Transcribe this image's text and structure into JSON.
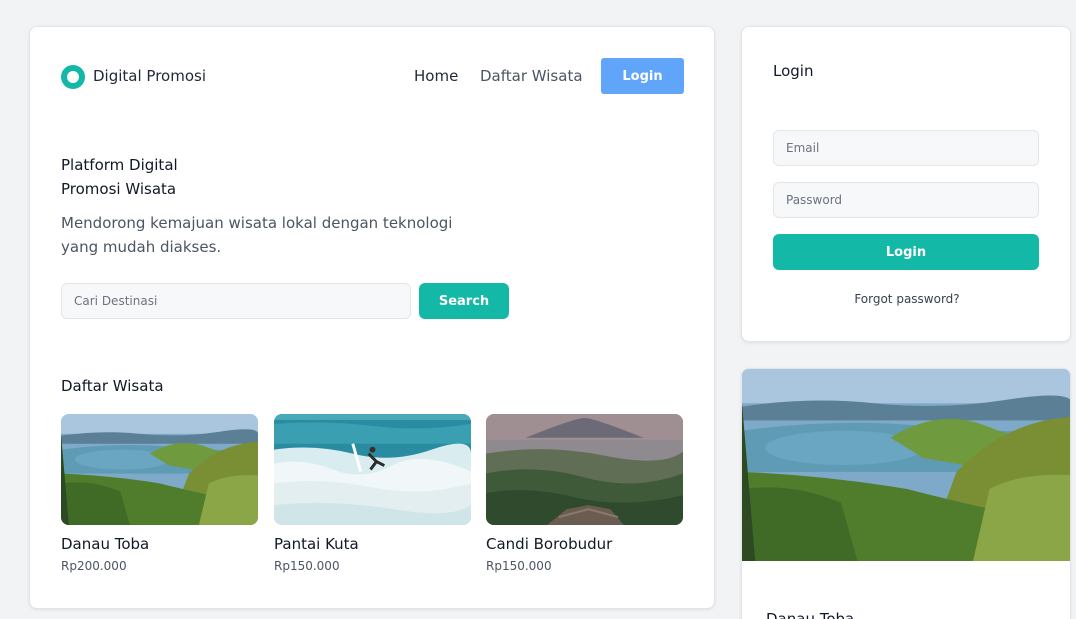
{
  "header": {
    "brand": "Digital Promosi",
    "nav": [
      "Home",
      "Daftar Wisata"
    ],
    "login_label": "Login"
  },
  "hero": {
    "title_line1": "Platform Digital",
    "title_line2": "Promosi Wisata",
    "subtitle": "Mendorong kemajuan wisata lokal dengan teknologi yang mudah diakses.",
    "search_placeholder": "Cari Destinasi",
    "search_label": "Search"
  },
  "destinations": {
    "section_title": "Daftar Wisata",
    "items": [
      {
        "name": "Danau Toba",
        "price": "Rp200.000",
        "image": "lake-landscape"
      },
      {
        "name": "Pantai Kuta",
        "price": "Rp150.000",
        "image": "surfer-waves"
      },
      {
        "name": "Candi Borobudur",
        "price": "Rp150.000",
        "image": "temple-volcano"
      }
    ]
  },
  "login": {
    "title": "Login",
    "email_placeholder": "Email",
    "password_placeholder": "Password",
    "submit_label": "Login",
    "forgot_label": "Forgot password?"
  },
  "featured": {
    "name": "Danau Toba",
    "image": "lake-landscape"
  },
  "colors": {
    "accent": "#14b8a6",
    "nav_button": "#60a5fa",
    "background": "#f2f3f5"
  }
}
